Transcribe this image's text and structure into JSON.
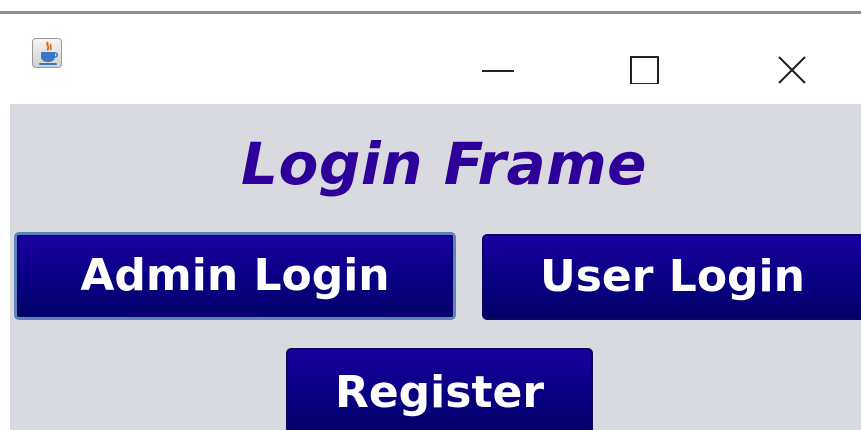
{
  "window": {
    "icon": "java-coffee-cup-icon",
    "controls": [
      "minimize-icon",
      "maximize-icon",
      "close-icon"
    ]
  },
  "frame": {
    "title": "Login Frame",
    "title_color": "#2F0099",
    "background_color": "#D8DAE0",
    "button_color": "#080082"
  },
  "buttons": {
    "admin_login": "Admin Login",
    "user_login": "User Login",
    "register": "Register"
  }
}
